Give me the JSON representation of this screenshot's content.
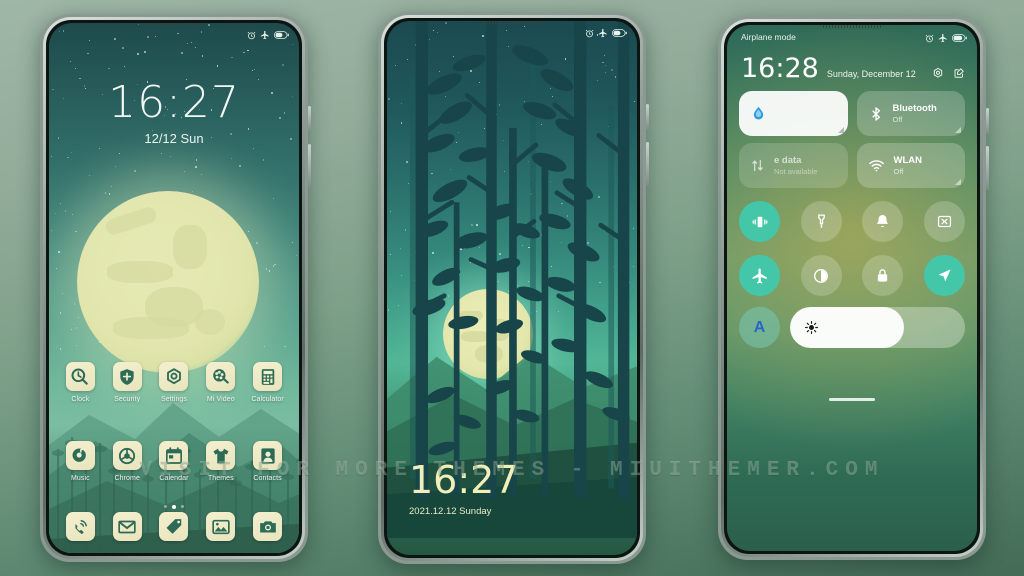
{
  "watermark": "VISIT FOR MORE THEMES - MIUITHEMER.COM",
  "phone1": {
    "name": "lockscreen-homescreen-phone",
    "statusbar": {
      "alarm_icon": "alarm-icon",
      "airplane_icon": "airplane-icon",
      "battery_icon": "battery-icon"
    },
    "clock": {
      "time": "16:27",
      "date": "12/12 Sun"
    },
    "apps_row1": [
      {
        "label": "Clock",
        "icon": "clock-icon"
      },
      {
        "label": "Security",
        "icon": "shield-icon"
      },
      {
        "label": "Settings",
        "icon": "gear-icon"
      },
      {
        "label": "Mi Video",
        "icon": "film-reel-icon"
      },
      {
        "label": "Calculator",
        "icon": "calculator-icon"
      }
    ],
    "apps_row2": [
      {
        "label": "Music",
        "icon": "music-note-icon"
      },
      {
        "label": "Chrome",
        "icon": "chrome-icon"
      },
      {
        "label": "Calendar",
        "icon": "calendar-icon"
      },
      {
        "label": "Themes",
        "icon": "tshirt-icon"
      },
      {
        "label": "Contacts",
        "icon": "contact-person-icon"
      }
    ],
    "dock": [
      {
        "icon": "phone-icon"
      },
      {
        "icon": "mail-icon"
      },
      {
        "icon": "notes-tag-icon"
      },
      {
        "icon": "gallery-icon"
      },
      {
        "icon": "camera-icon"
      }
    ],
    "page_dots": 3,
    "active_dot": 1
  },
  "phone2": {
    "name": "forest-lockscreen-phone",
    "statusbar": {
      "alarm_icon": "alarm-icon",
      "airplane_icon": "airplane-icon",
      "battery_icon": "battery-icon"
    },
    "clock": {
      "time": "16:27",
      "date": "2021.12.12 Sunday"
    }
  },
  "phone3": {
    "name": "control-center-phone",
    "status_label": "Airplane mode",
    "statusbar": {
      "alarm_icon": "alarm-icon",
      "airplane_icon": "airplane-icon",
      "battery_icon": "battery-icon"
    },
    "clock": {
      "time": "16:28",
      "date": "Sunday, December 12"
    },
    "header_icons": [
      "settings-gear-icon",
      "edit-icon"
    ],
    "cards": [
      {
        "name": "water-card",
        "icon": "water-drop-icon",
        "title": "",
        "subtitle": "",
        "style": "light"
      },
      {
        "name": "bluetooth-card",
        "icon": "bluetooth-icon",
        "title": "Bluetooth",
        "subtitle": "Off",
        "style": "dim"
      },
      {
        "name": "mobile-data-card",
        "icon": "data-transfer-icon",
        "title": "e data",
        "subtitle": "Not available",
        "style": "dim"
      },
      {
        "name": "wlan-card",
        "icon": "wifi-icon",
        "title": "WLAN",
        "subtitle": "Off",
        "style": "dim"
      }
    ],
    "toggles_row1": [
      {
        "name": "vibrate-toggle",
        "icon": "vibrate-icon",
        "state": "on"
      },
      {
        "name": "flashlight-toggle",
        "icon": "flashlight-icon",
        "state": "off"
      },
      {
        "name": "ringtone-toggle",
        "icon": "bell-icon",
        "state": "off"
      },
      {
        "name": "screenshot-toggle",
        "icon": "screenshot-scissors-icon",
        "state": "off"
      }
    ],
    "toggles_row2": [
      {
        "name": "airplane-toggle",
        "icon": "airplane-icon",
        "state": "on"
      },
      {
        "name": "dark-mode-toggle",
        "icon": "contrast-circle-icon",
        "state": "off"
      },
      {
        "name": "lock-rotation-toggle",
        "icon": "lock-icon",
        "state": "off"
      },
      {
        "name": "location-toggle",
        "icon": "location-arrow-icon",
        "state": "on"
      }
    ],
    "auto_brightness": {
      "name": "auto-brightness-toggle",
      "label": "A",
      "state": "on"
    },
    "brightness_slider": {
      "name": "brightness-slider",
      "icon": "sun-icon",
      "value": 65
    }
  }
}
